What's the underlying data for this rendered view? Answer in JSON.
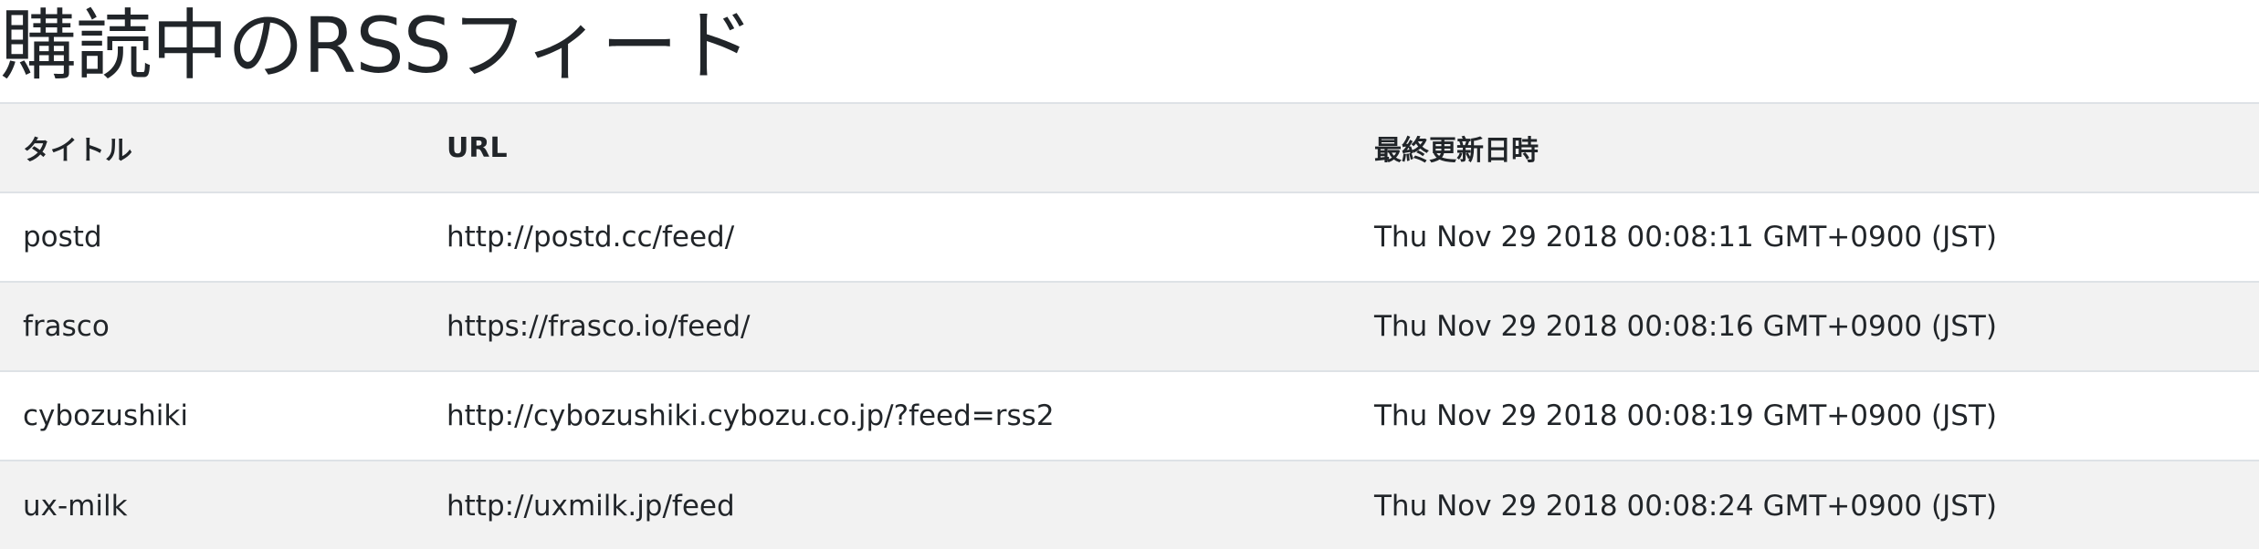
{
  "page": {
    "title": "購読中のRSSフィード"
  },
  "table": {
    "headers": {
      "title": "タイトル",
      "url": "URL",
      "updated": "最終更新日時"
    },
    "rows": [
      {
        "title": "postd",
        "url": "http://postd.cc/feed/",
        "updated": "Thu Nov 29 2018 00:08:11 GMT+0900 (JST)"
      },
      {
        "title": "frasco",
        "url": "https://frasco.io/feed/",
        "updated": "Thu Nov 29 2018 00:08:16 GMT+0900 (JST)"
      },
      {
        "title": "cybozushiki",
        "url": "http://cybozushiki.cybozu.co.jp/?feed=rss2",
        "updated": "Thu Nov 29 2018 00:08:19 GMT+0900 (JST)"
      },
      {
        "title": "ux-milk",
        "url": "http://uxmilk.jp/feed",
        "updated": "Thu Nov 29 2018 00:08:24 GMT+0900 (JST)"
      }
    ]
  },
  "colors": {
    "text": "#212529",
    "header_bg": "#f2f2f2",
    "stripe_bg": "#f2f2f2",
    "border": "#dee2e6"
  }
}
